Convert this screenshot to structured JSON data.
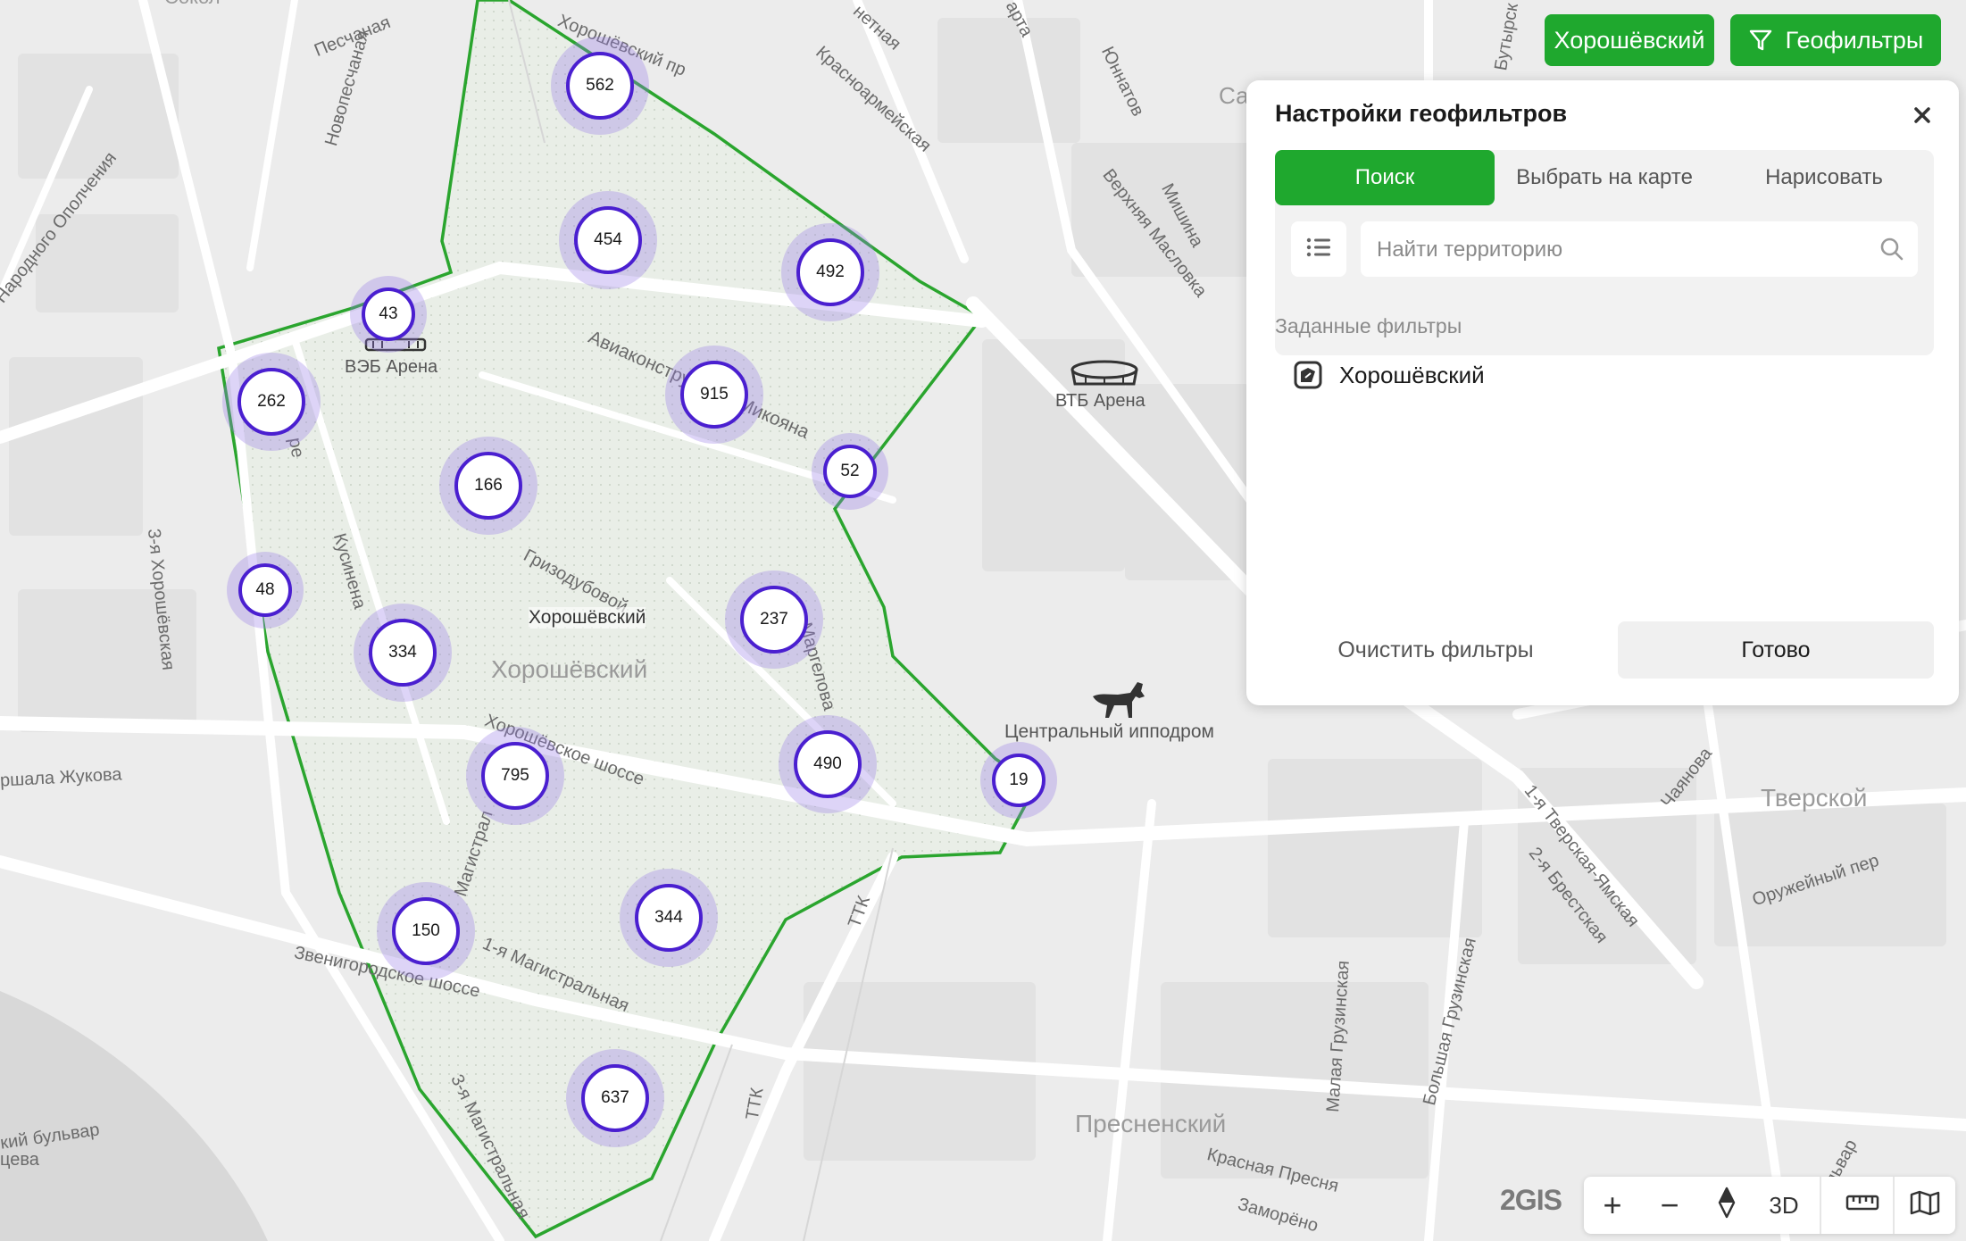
{
  "map": {
    "labels": {
      "sokol": "Сокол",
      "peschanaya": "Песчаная",
      "novopeschanaya": "Новопесчаная",
      "narodnogo": "Народного Ополчения",
      "khoroshevskiy_pr": "Хорошёвский пр",
      "krasnoarmeyskaya": "Красноармейская",
      "yunnatov": "Юннатов",
      "mishina": "Мишина",
      "verkhnyaya_maslovka": "Верхняя Масловка",
      "butyrskaya": "Бутырск",
      "aviakonstruktora": "Авиаконструктора Микояна",
      "veb_arena": "ВЭБ Арена",
      "vtb_arena": "ВТБ Арена",
      "kusinena": "Кусинена",
      "khoroshevskaya3": "3-я Хорошёвская",
      "grizodubovoy": "Гризодубовой",
      "khoroshevskiy_small": "Хорошёвский",
      "khoroshevskiy_big": "Хорошёвский",
      "margelova": "Маргелова",
      "marshala_zhukova": "ршала Жукова",
      "khoroshevskoe_shosse": "Хорошёвское шоссе",
      "hippodrome": "Центральный ипподром",
      "magistralnaya": "Магистрал",
      "zvenigorodskoe": "Звенигородское шоссе",
      "magistralnaya1": "1-я Магистральная",
      "magistralnaya3": "3-я Магистральная",
      "ttk1": "ТТК",
      "ttk2": "ТТК",
      "tverskoy": "Тверской",
      "tverskaya_yamskaya": "1-я Тверская-Ямская",
      "brestskaya": "2-я Брестская",
      "chayanova": "Чаянова",
      "oruzheyny": "Оружейный пер",
      "malaya_gruzinskaya": "Малая Грузинская",
      "bolshaya_gruzinskaya": "Большая Грузинская",
      "presnenskiy": "Пресненский",
      "krasnaya_presnya": "Красная Пресня",
      "zamorenova": "Заморёно",
      "bulvar": "кий бульвар",
      "tseva": "цева",
      "bulvar_right": "бульвар",
      "sa": "Са",
      "netnaya": "нетная",
      "karta": "арта",
      "ero": "ре"
    },
    "clusters": [
      {
        "id": "c562",
        "value": "562"
      },
      {
        "id": "c454",
        "value": "454"
      },
      {
        "id": "c492",
        "value": "492"
      },
      {
        "id": "c43",
        "value": "43"
      },
      {
        "id": "c262",
        "value": "262"
      },
      {
        "id": "c915",
        "value": "915"
      },
      {
        "id": "c52",
        "value": "52"
      },
      {
        "id": "c166",
        "value": "166"
      },
      {
        "id": "c48",
        "value": "48"
      },
      {
        "id": "c237",
        "value": "237"
      },
      {
        "id": "c334",
        "value": "334"
      },
      {
        "id": "c795",
        "value": "795"
      },
      {
        "id": "c490",
        "value": "490"
      },
      {
        "id": "c19",
        "value": "19"
      },
      {
        "id": "c150",
        "value": "150"
      },
      {
        "id": "c344",
        "value": "344"
      },
      {
        "id": "c637",
        "value": "637"
      }
    ],
    "colors": {
      "boundary": "#2aa52e",
      "cluster_ring": "#4a1fd0",
      "accent": "#1fa82e"
    }
  },
  "header": {
    "district_button": "Хорошёвский",
    "geofilters_button": "Геофильтры"
  },
  "panel": {
    "title": "Настройки геофильтров",
    "tabs": [
      "Поиск",
      "Выбрать на карте",
      "Нарисовать"
    ],
    "search_placeholder": "Найти территорию",
    "section_label": "Заданные фильтры",
    "filters": [
      "Хорошёвский"
    ],
    "clear_button": "Очистить фильтры",
    "done_button": "Готово"
  },
  "controls": {
    "logo": "2GIS",
    "zoom_in": "+",
    "zoom_out": "−",
    "mode_3d": "3D"
  }
}
